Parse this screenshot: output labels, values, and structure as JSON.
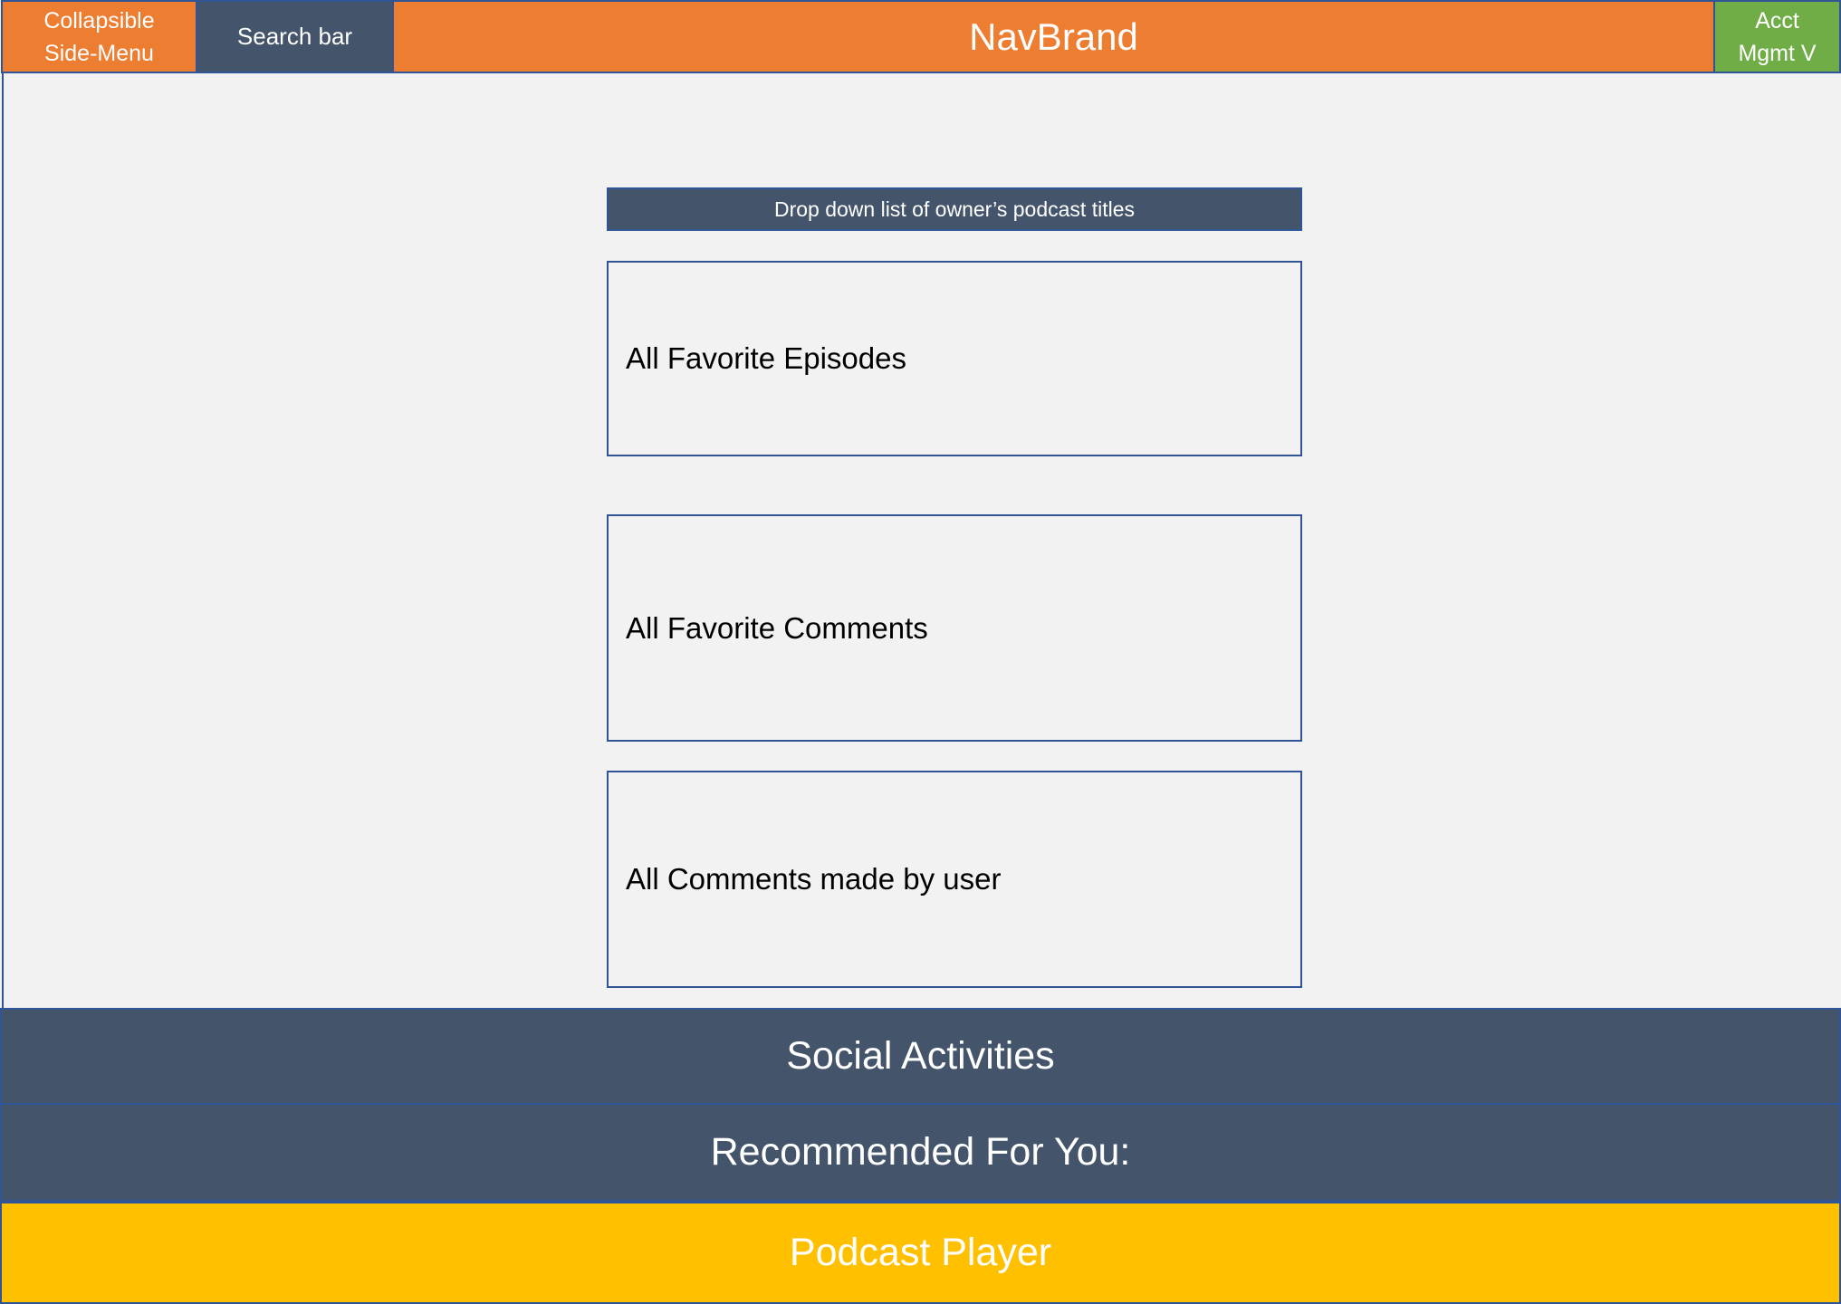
{
  "navbar": {
    "menu_line1": "Collapsible",
    "menu_line2": "Side-Menu",
    "search_label": "Search bar",
    "brand": "NavBrand",
    "acct_line1": "Acct",
    "acct_line2": "Mgmt V"
  },
  "main": {
    "dropdown_label": "Drop down list of owner’s podcast titles",
    "panels": [
      {
        "label": "All Favorite Episodes"
      },
      {
        "label": "All Favorite Comments"
      },
      {
        "label": "All Comments made by user"
      }
    ]
  },
  "footer": {
    "social": "Social Activities",
    "recommended": "Recommended For You:",
    "player": "Podcast Player"
  },
  "colors": {
    "nav_orange": "#ed7d31",
    "slate": "#44546a",
    "acct_green": "#70ad47",
    "player_yellow": "#ffc000",
    "border_blue": "#2f5597",
    "background": "#f2f2f2"
  }
}
